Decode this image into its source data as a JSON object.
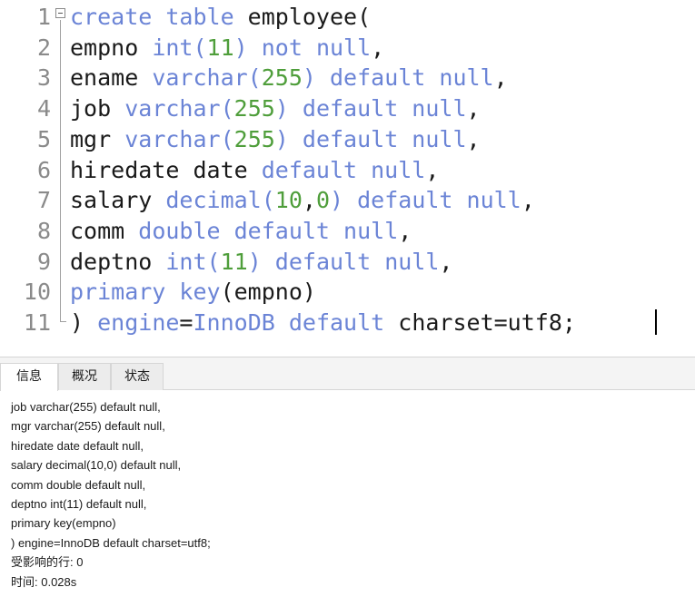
{
  "editor": {
    "lines": [
      {
        "number": "1",
        "parts": [
          {
            "t": "kw",
            "v": "create table "
          },
          {
            "t": "plain",
            "v": "employee("
          }
        ]
      },
      {
        "number": "2",
        "parts": [
          {
            "t": "plain",
            "v": "empno "
          },
          {
            "t": "kw",
            "v": "int("
          },
          {
            "t": "num",
            "v": "11"
          },
          {
            "t": "kw",
            "v": ") not null"
          },
          {
            "t": "plain",
            "v": ","
          }
        ]
      },
      {
        "number": "3",
        "parts": [
          {
            "t": "plain",
            "v": "ename "
          },
          {
            "t": "kw",
            "v": "varchar("
          },
          {
            "t": "num",
            "v": "255"
          },
          {
            "t": "kw",
            "v": ") default null"
          },
          {
            "t": "plain",
            "v": ","
          }
        ]
      },
      {
        "number": "4",
        "parts": [
          {
            "t": "plain",
            "v": "job "
          },
          {
            "t": "kw",
            "v": "varchar("
          },
          {
            "t": "num",
            "v": "255"
          },
          {
            "t": "kw",
            "v": ") default null"
          },
          {
            "t": "plain",
            "v": ","
          }
        ]
      },
      {
        "number": "5",
        "parts": [
          {
            "t": "plain",
            "v": "mgr "
          },
          {
            "t": "kw",
            "v": "varchar("
          },
          {
            "t": "num",
            "v": "255"
          },
          {
            "t": "kw",
            "v": ") default null"
          },
          {
            "t": "plain",
            "v": ","
          }
        ]
      },
      {
        "number": "6",
        "parts": [
          {
            "t": "plain",
            "v": "hiredate date "
          },
          {
            "t": "kw",
            "v": "default null"
          },
          {
            "t": "plain",
            "v": ","
          }
        ]
      },
      {
        "number": "7",
        "parts": [
          {
            "t": "plain",
            "v": "salary "
          },
          {
            "t": "kw",
            "v": "decimal("
          },
          {
            "t": "num",
            "v": "10"
          },
          {
            "t": "plain",
            "v": ","
          },
          {
            "t": "num",
            "v": "0"
          },
          {
            "t": "kw",
            "v": ") default null"
          },
          {
            "t": "plain",
            "v": ","
          }
        ]
      },
      {
        "number": "8",
        "parts": [
          {
            "t": "plain",
            "v": "comm "
          },
          {
            "t": "kw",
            "v": "double default null"
          },
          {
            "t": "plain",
            "v": ","
          }
        ]
      },
      {
        "number": "9",
        "parts": [
          {
            "t": "plain",
            "v": "deptno "
          },
          {
            "t": "kw",
            "v": "int("
          },
          {
            "t": "num",
            "v": "11"
          },
          {
            "t": "kw",
            "v": ") default null"
          },
          {
            "t": "plain",
            "v": ","
          }
        ]
      },
      {
        "number": "10",
        "parts": [
          {
            "t": "kw",
            "v": "primary key"
          },
          {
            "t": "plain",
            "v": "(empno)"
          }
        ]
      },
      {
        "number": "11",
        "parts": [
          {
            "t": "plain",
            "v": ") "
          },
          {
            "t": "kw",
            "v": "engine"
          },
          {
            "t": "plain",
            "v": "="
          },
          {
            "t": "kw",
            "v": "InnoDB default "
          },
          {
            "t": "plain",
            "v": "charset=utf8;"
          }
        ]
      }
    ]
  },
  "result_panel": {
    "tabs": [
      {
        "label": "信息",
        "active": true
      },
      {
        "label": "概况",
        "active": false
      },
      {
        "label": "状态",
        "active": false
      }
    ],
    "output_lines": [
      "job varchar(255) default null,",
      "mgr varchar(255) default null,",
      "hiredate date default null,",
      "salary decimal(10,0) default null,",
      "comm double default null,",
      "deptno int(11) default null,",
      "primary key(empno)",
      ") engine=InnoDB default charset=utf8;",
      "受影响的行: 0",
      "时间: 0.028s"
    ]
  },
  "colors": {
    "keyword": "#6b84d6",
    "number": "#4f9e3b",
    "plain": "#1a1a1a",
    "line_number": "#8a8a8a"
  }
}
